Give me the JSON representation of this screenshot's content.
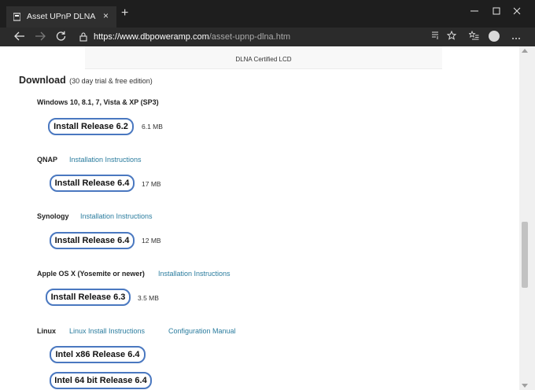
{
  "browser": {
    "tab_title": "Asset UPnP DLNA",
    "tab_close": "×",
    "new_tab": "+",
    "url_main": "https://www.dbpoweramp.com",
    "url_path": "/asset-upnp-dlna.htm",
    "icons": [
      "back-icon",
      "forward-icon",
      "refresh-icon",
      "lock-icon",
      "reader-view-icon",
      "favorite-star-icon",
      "favorites-list-icon",
      "profile-avatar-icon",
      "more-options-icon",
      "minimize-icon",
      "maximize-icon",
      "window-close-icon"
    ]
  },
  "page": {
    "cert_label": "DLNA Certified LCD",
    "download_heading": "Download",
    "download_subtitle": "(30 day trial & free edition)",
    "sections": [
      {
        "os": "Windows 10, 8.1, 7, Vista & XP (SP3)",
        "button": "Install Release 6.2",
        "size": "6.1 MB"
      },
      {
        "os": "QNAP",
        "link": "Installation Instructions",
        "button": "Install Release 6.4",
        "size": "17 MB"
      },
      {
        "os": "Synology",
        "link": "Installation Instructions",
        "button": "Install Release 6.4",
        "size": "12 MB"
      },
      {
        "os": "Apple OS X (Yosemite or newer)",
        "link": "Installation Instructions",
        "button": "Install Release 6.3",
        "size": "3.5 MB"
      },
      {
        "os": "Linux",
        "link": "Linux Install Instructions",
        "link2": "Configuration Manual",
        "button": "Intel x86 Release 6.4",
        "button2": "Intel 64 bit Release 6.4"
      }
    ]
  },
  "colors": {
    "titlebar": "#1e1e1e",
    "toolbar": "#2b2b2b",
    "link": "#2a7c9e",
    "button_border": "#4a78c0"
  }
}
